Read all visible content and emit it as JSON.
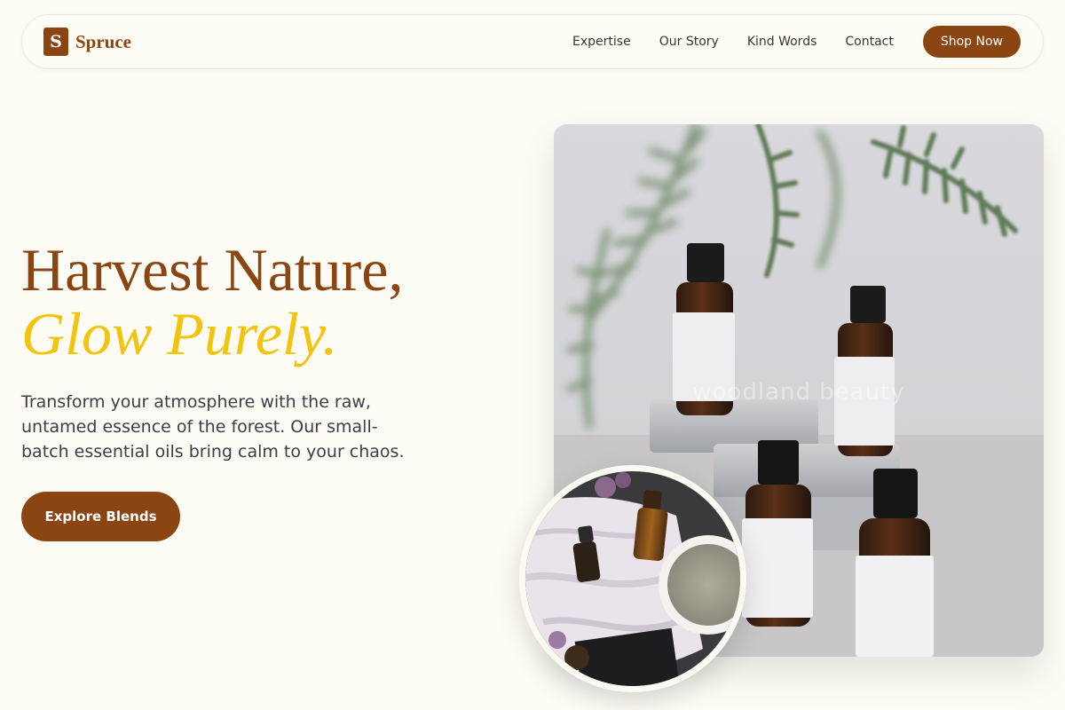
{
  "brand": {
    "logo_letter": "S",
    "name": "Spruce"
  },
  "nav": {
    "links": [
      "Expertise",
      "Our Story",
      "Kind Words",
      "Contact"
    ],
    "cta_label": "Shop Now"
  },
  "hero": {
    "title_line1": "Harvest Nature,",
    "title_line2": "Glow Purely.",
    "description": "Transform your atmosphere with the raw, untamed essence of the forest. Our small-batch essential oils bring calm to your chaos.",
    "button_label": "Explore Blends"
  },
  "images": {
    "main_watermark": "woodland beauty"
  },
  "colors": {
    "background": "#fdfcf4",
    "brand_brown": "#8b4513",
    "accent_yellow": "#f1c40f",
    "body_text": "#3b3e46"
  }
}
